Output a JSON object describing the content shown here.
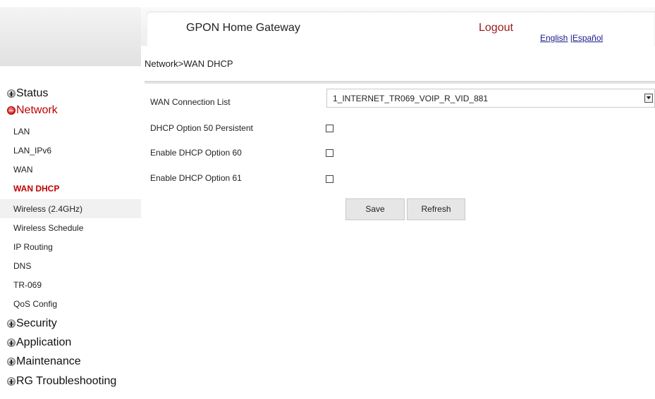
{
  "header": {
    "app_title": "GPON Home Gateway",
    "logout": "Logout",
    "lang_english": "English",
    "lang_separator": " |",
    "lang_spanish": "Español"
  },
  "breadcrumb": "Network>WAN DHCP",
  "sidebar": {
    "status": "Status",
    "network": "Network",
    "network_items": [
      "LAN",
      "LAN_IPv6",
      "WAN",
      "WAN DHCP",
      "Wireless (2.4GHz)",
      "Wireless Schedule",
      "IP Routing",
      "DNS",
      "TR-069",
      "QoS Config"
    ],
    "active_item": "WAN DHCP",
    "security": "Security",
    "application": "Application",
    "maintenance": "Maintenance",
    "rg_troubleshooting": "RG Troubleshooting"
  },
  "form": {
    "wan_connection_list_label": "WAN Connection List",
    "wan_connection_value": "1_INTERNET_TR069_VOIP_R_VID_881",
    "option50_label": "DHCP Option 50 Persistent",
    "option60_label": "Enable DHCP Option 60",
    "option61_label": "Enable DHCP Option 61",
    "option50_checked": false,
    "option60_checked": false,
    "option61_checked": false,
    "save_label": "Save",
    "refresh_label": "Refresh"
  },
  "colors": {
    "logout": "#9b1b1b",
    "active_menu": "#c00000",
    "link": "#1a1a8c"
  }
}
